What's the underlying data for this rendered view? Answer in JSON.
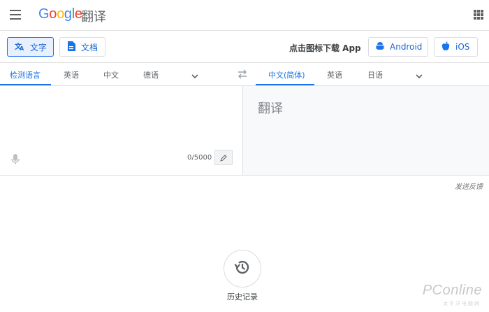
{
  "header": {
    "logo_letters": [
      "G",
      "o",
      "o",
      "g",
      "l",
      "e"
    ],
    "product": "翻译",
    "menu_icon": "hamburger-menu-icon",
    "apps_icon": "apps-grid-icon"
  },
  "modes": {
    "text_label": "文字",
    "doc_label": "文档",
    "promo": "点击图标下载 App",
    "android_label": "Android",
    "ios_label": "iOS"
  },
  "source_langs": [
    "检测语言",
    "英语",
    "中文",
    "德语"
  ],
  "target_langs": [
    "中文(简体)",
    "英语",
    "日语"
  ],
  "source": {
    "value": "",
    "count": "0/5000"
  },
  "target": {
    "placeholder": "翻译"
  },
  "feedback": "发送反馈",
  "history": {
    "label": "历史记录"
  },
  "watermark": {
    "brand": "PConline",
    "sub": "太平洋电脑网"
  },
  "colors": {
    "accent": "#1a73e8",
    "logo_blue": "#4285f4",
    "logo_red": "#ea4335",
    "logo_yellow": "#fbbc05",
    "logo_green": "#34a853"
  }
}
